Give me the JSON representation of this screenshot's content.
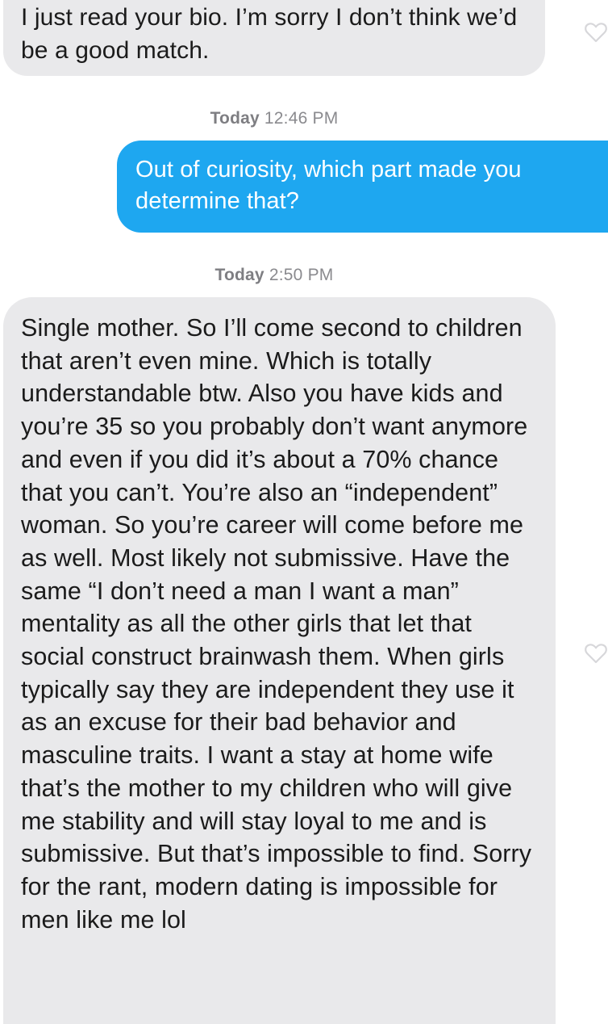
{
  "conversation": {
    "messages": [
      {
        "sender": "them",
        "text": "I just read your bio. I’m sorry I don’t think we’d be a good match."
      },
      {
        "sender": "me",
        "text": "Out of curiosity, which part made you determine that?"
      },
      {
        "sender": "them",
        "text": "Single mother. So I’ll come second to children that aren’t even mine. Which is totally understandable btw. Also you have kids and you’re 35 so you probably don’t want anymore and even if you did it’s about a 70% chance that you can’t. You’re also an “independent” woman. So you’re career will come before me as well. Most likely not submissive. Have the same “I don’t need a man I want a man” mentality as all the other girls that let that social construct brainwash them. When girls typically say they are independent they use it as an excuse for their bad behavior and masculine traits. I want a stay at home wife that’s the mother to my children who will give me stability and will stay loyal to me and is submissive. But that’s impossible to find. Sorry for the rant, modern dating is impossible for men like me lol"
      }
    ],
    "timestamps": [
      {
        "day": "Today",
        "time": "12:46 PM"
      },
      {
        "day": "Today",
        "time": "2:50 PM"
      }
    ]
  },
  "icons": {
    "like": "heart-outline-icon"
  },
  "colors": {
    "sent_bubble": "#1ea7f0",
    "received_bubble": "#e9e9eb",
    "timestamp_text": "#8a8a8e"
  }
}
